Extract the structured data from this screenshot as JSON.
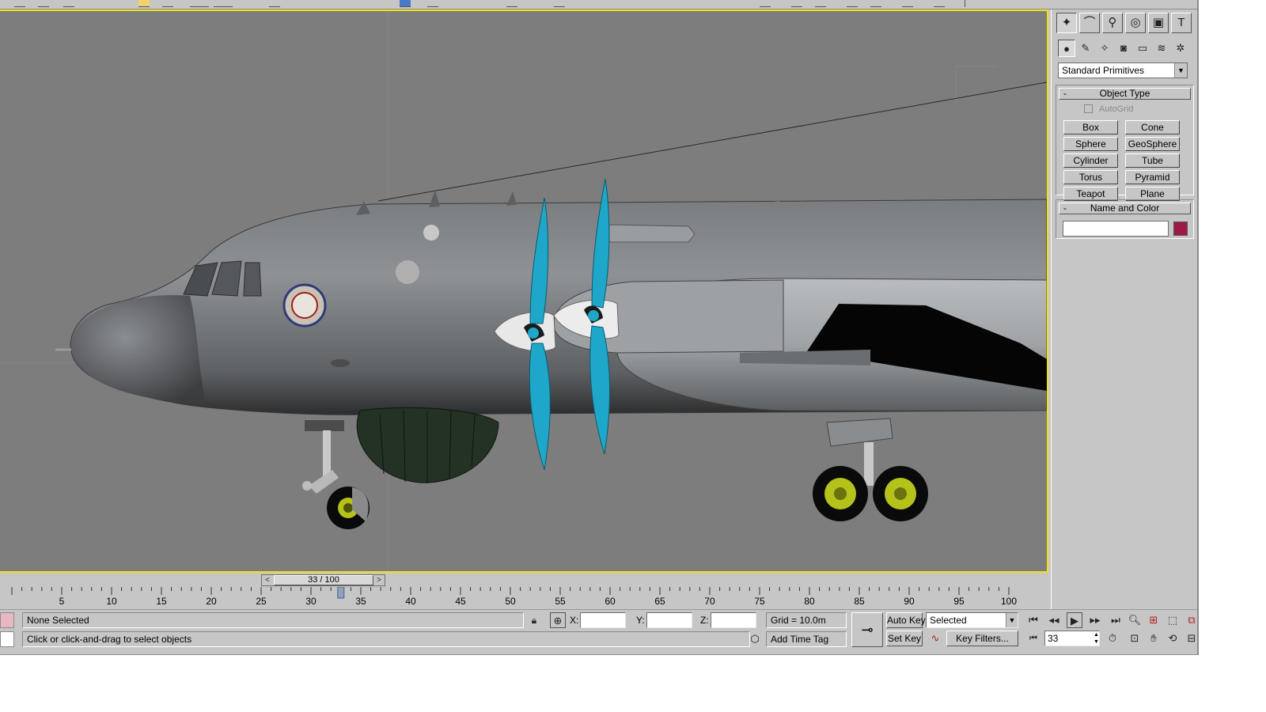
{
  "command_panel": {
    "tabs": [
      {
        "name": "create",
        "glyph": "✦"
      },
      {
        "name": "modify",
        "glyph": "⌒"
      },
      {
        "name": "hierarchy",
        "glyph": "⚲"
      },
      {
        "name": "motion",
        "glyph": "◎"
      },
      {
        "name": "display",
        "glyph": "▣"
      },
      {
        "name": "utilities",
        "glyph": "T"
      }
    ],
    "categories": [
      {
        "name": "geometry",
        "glyph": "●"
      },
      {
        "name": "shapes",
        "glyph": "✎"
      },
      {
        "name": "lights",
        "glyph": "✧"
      },
      {
        "name": "cameras",
        "glyph": "◙"
      },
      {
        "name": "helpers",
        "glyph": "▭"
      },
      {
        "name": "space-warps",
        "glyph": "≋"
      },
      {
        "name": "systems",
        "glyph": "✲"
      }
    ],
    "primitive_type": "Standard Primitives",
    "object_type": {
      "title": "Object Type",
      "collapse": "-",
      "autogrid_label": "AutoGrid",
      "buttons": [
        "Box",
        "Cone",
        "Sphere",
        "GeoSphere",
        "Cylinder",
        "Tube",
        "Torus",
        "Pyramid",
        "Teapot",
        "Plane"
      ]
    },
    "name_and_color": {
      "title": "Name and Color",
      "collapse": "-",
      "name_value": "",
      "swatch_color": "#9e1a45"
    }
  },
  "time_slider": {
    "label": "33 / 100",
    "left_arrow": "<",
    "right_arrow": ">",
    "current_frame": 33,
    "total_frames": 100
  },
  "trackbar": {
    "ticks": [
      5,
      10,
      15,
      20,
      25,
      30,
      35,
      40,
      45,
      50,
      55,
      60,
      65,
      70,
      75,
      80,
      85,
      90,
      95,
      100
    ]
  },
  "status": {
    "selection": "None Selected",
    "prompt": "Click or click-and-drag to select objects",
    "x_label": "X:",
    "y_label": "Y:",
    "z_label": "Z:",
    "x_value": "",
    "y_value": "",
    "z_value": "",
    "grid": "Grid = 10.0m",
    "add_time_tag": "Add Time Tag",
    "auto_key": "Auto Key",
    "set_key": "Set Key",
    "key_mode": "Selected",
    "key_filters": "Key Filters...",
    "frame_value": "33"
  },
  "colors": {
    "viewport_bg": "#7d7d7d",
    "viewport_border": "#f2e01a",
    "propeller": "#1fa7c9",
    "wheel_hub": "#b5c21a",
    "fuselage": "#8a8d90"
  }
}
